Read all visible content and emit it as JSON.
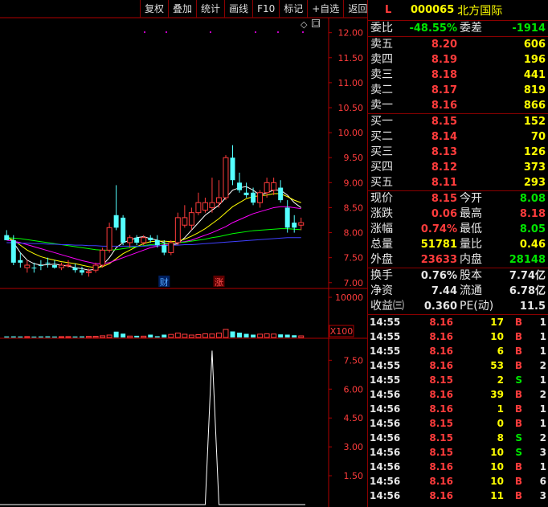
{
  "toolbar": [
    {
      "id": "fuquan",
      "label": "复权"
    },
    {
      "id": "diejia",
      "label": "叠加"
    },
    {
      "id": "tongji",
      "label": "统计"
    },
    {
      "id": "huaxian",
      "label": "画线"
    },
    {
      "id": "f10",
      "label": "F10"
    },
    {
      "id": "biaoji",
      "label": "标记"
    },
    {
      "id": "zixuan",
      "label": "+自选"
    },
    {
      "id": "fanhui",
      "label": "返回"
    }
  ],
  "chart_icons": {
    "diamond": "◇",
    "window": "□"
  },
  "header": {
    "market": "L",
    "code": "000065",
    "name": "北方国际"
  },
  "weibi": {
    "label": "委比",
    "value": "-48.55%",
    "label2": "委差",
    "value2": "-1914"
  },
  "asks": [
    {
      "label": "卖五",
      "price": "8.20",
      "vol": "606"
    },
    {
      "label": "卖四",
      "price": "8.19",
      "vol": "196"
    },
    {
      "label": "卖三",
      "price": "8.18",
      "vol": "441"
    },
    {
      "label": "卖二",
      "price": "8.17",
      "vol": "819"
    },
    {
      "label": "卖一",
      "price": "8.16",
      "vol": "866"
    }
  ],
  "bids": [
    {
      "label": "买一",
      "price": "8.15",
      "vol": "152"
    },
    {
      "label": "买二",
      "price": "8.14",
      "vol": "70"
    },
    {
      "label": "买三",
      "price": "8.13",
      "vol": "126"
    },
    {
      "label": "买四",
      "price": "8.12",
      "vol": "373"
    },
    {
      "label": "买五",
      "price": "8.11",
      "vol": "293"
    }
  ],
  "stats": [
    {
      "l1": "现价",
      "v1": "8.15",
      "c1": "red",
      "l2": "今开",
      "v2": "8.08",
      "c2": "green"
    },
    {
      "l1": "涨跌",
      "v1": "0.06",
      "c1": "red",
      "l2": "最高",
      "v2": "8.18",
      "c2": "red"
    },
    {
      "l1": "涨幅",
      "v1": "0.74%",
      "c1": "red",
      "l2": "最低",
      "v2": "8.05",
      "c2": "green"
    },
    {
      "l1": "总量",
      "v1": "51781",
      "c1": "yellow",
      "l2": "量比",
      "v2": "0.46",
      "c2": "yellow"
    },
    {
      "l1": "外盘",
      "v1": "23633",
      "c1": "red",
      "l2": "内盘",
      "v2": "28148",
      "c2": "green"
    }
  ],
  "stats2": [
    {
      "l1": "换手",
      "v1": "0.76%",
      "c1": "white",
      "l2": "股本",
      "v2": "7.74亿",
      "c2": "white"
    },
    {
      "l1": "净资",
      "v1": "7.44",
      "c1": "white",
      "l2": "流通",
      "v2": "6.78亿",
      "c2": "white"
    },
    {
      "l1": "收益㈢",
      "v1": "0.360",
      "c1": "white",
      "l2": "PE(动)",
      "v2": "11.5",
      "c2": "white"
    }
  ],
  "ticks": [
    {
      "time": "14:55",
      "price": "8.16",
      "vol": "17",
      "dir": "B",
      "n": "1"
    },
    {
      "time": "14:55",
      "price": "8.16",
      "vol": "10",
      "dir": "B",
      "n": "1"
    },
    {
      "time": "14:55",
      "price": "8.16",
      "vol": "6",
      "dir": "B",
      "n": "1"
    },
    {
      "time": "14:55",
      "price": "8.16",
      "vol": "53",
      "dir": "B",
      "n": "2"
    },
    {
      "time": "14:55",
      "price": "8.15",
      "vol": "2",
      "dir": "S",
      "n": "1"
    },
    {
      "time": "14:56",
      "price": "8.16",
      "vol": "39",
      "dir": "B",
      "n": "2"
    },
    {
      "time": "14:56",
      "price": "8.16",
      "vol": "1",
      "dir": "B",
      "n": "1"
    },
    {
      "time": "14:56",
      "price": "8.15",
      "vol": "0",
      "dir": "B",
      "n": "1"
    },
    {
      "time": "14:56",
      "price": "8.15",
      "vol": "8",
      "dir": "S",
      "n": "2"
    },
    {
      "time": "14:56",
      "price": "8.15",
      "vol": "10",
      "dir": "S",
      "n": "3"
    },
    {
      "time": "14:56",
      "price": "8.16",
      "vol": "10",
      "dir": "B",
      "n": "1"
    },
    {
      "time": "14:56",
      "price": "8.16",
      "vol": "10",
      "dir": "B",
      "n": "6"
    },
    {
      "time": "14:56",
      "price": "8.16",
      "vol": "11",
      "dir": "B",
      "n": "3"
    }
  ],
  "chart_data": [
    {
      "type": "candlestick",
      "ylim": [
        6.9,
        12.3
      ],
      "yticks": [
        "12.00",
        "11.50",
        "11.00",
        "10.50",
        "10.00",
        "9.50",
        "9.00",
        "8.50",
        "8.00",
        "7.50",
        "7.00"
      ],
      "ytick_values": [
        12.0,
        11.5,
        11.0,
        10.5,
        10.0,
        9.5,
        9.0,
        8.5,
        8.0,
        7.5,
        7.0
      ],
      "candles": [
        {
          "o": 7.95,
          "h": 8.05,
          "l": 7.85,
          "c": 7.85,
          "col": "cyan"
        },
        {
          "o": 7.85,
          "h": 7.95,
          "l": 7.35,
          "c": 7.4,
          "col": "cyan"
        },
        {
          "o": 7.45,
          "h": 7.6,
          "l": 7.3,
          "c": 7.4,
          "col": "cyan"
        },
        {
          "o": 7.35,
          "h": 7.45,
          "l": 7.2,
          "c": 7.3,
          "col": "red"
        },
        {
          "o": 7.3,
          "h": 7.4,
          "l": 7.2,
          "c": 7.3,
          "col": "cyan"
        },
        {
          "o": 7.35,
          "h": 7.45,
          "l": 7.25,
          "c": 7.35,
          "col": "cyan"
        },
        {
          "o": 7.4,
          "h": 7.5,
          "l": 7.3,
          "c": 7.4,
          "col": "cyan"
        },
        {
          "o": 7.35,
          "h": 7.45,
          "l": 7.28,
          "c": 7.3,
          "col": "cyan"
        },
        {
          "o": 7.3,
          "h": 7.4,
          "l": 7.25,
          "c": 7.35,
          "col": "red"
        },
        {
          "o": 7.35,
          "h": 7.45,
          "l": 7.3,
          "c": 7.35,
          "col": "red"
        },
        {
          "o": 7.3,
          "h": 7.38,
          "l": 7.2,
          "c": 7.25,
          "col": "cyan"
        },
        {
          "o": 7.25,
          "h": 7.32,
          "l": 7.15,
          "c": 7.2,
          "col": "cyan"
        },
        {
          "o": 7.2,
          "h": 7.28,
          "l": 7.12,
          "c": 7.22,
          "col": "red"
        },
        {
          "o": 7.25,
          "h": 7.4,
          "l": 7.2,
          "c": 7.35,
          "col": "red"
        },
        {
          "o": 7.35,
          "h": 7.7,
          "l": 7.3,
          "c": 7.65,
          "col": "red"
        },
        {
          "o": 7.65,
          "h": 8.2,
          "l": 7.6,
          "c": 8.1,
          "col": "red"
        },
        {
          "o": 8.1,
          "h": 8.95,
          "l": 8.05,
          "c": 8.35,
          "col": "cyan"
        },
        {
          "o": 8.3,
          "h": 8.35,
          "l": 7.75,
          "c": 7.8,
          "col": "cyan"
        },
        {
          "o": 7.8,
          "h": 7.95,
          "l": 7.7,
          "c": 7.9,
          "col": "red"
        },
        {
          "o": 7.9,
          "h": 7.95,
          "l": 7.75,
          "c": 7.8,
          "col": "cyan"
        },
        {
          "o": 7.8,
          "h": 7.95,
          "l": 7.75,
          "c": 7.9,
          "col": "red"
        },
        {
          "o": 7.9,
          "h": 7.95,
          "l": 7.8,
          "c": 7.85,
          "col": "cyan"
        },
        {
          "o": 7.85,
          "h": 7.95,
          "l": 7.7,
          "c": 7.75,
          "col": "cyan"
        },
        {
          "o": 7.75,
          "h": 7.85,
          "l": 7.55,
          "c": 7.6,
          "col": "cyan"
        },
        {
          "o": 7.6,
          "h": 7.85,
          "l": 7.55,
          "c": 7.8,
          "col": "red"
        },
        {
          "o": 7.8,
          "h": 8.4,
          "l": 7.75,
          "c": 8.3,
          "col": "red"
        },
        {
          "o": 8.3,
          "h": 8.55,
          "l": 8.1,
          "c": 8.15,
          "col": "red"
        },
        {
          "o": 8.15,
          "h": 8.5,
          "l": 8.05,
          "c": 8.4,
          "col": "red"
        },
        {
          "o": 8.4,
          "h": 8.8,
          "l": 8.35,
          "c": 8.6,
          "col": "red"
        },
        {
          "o": 8.6,
          "h": 8.7,
          "l": 8.4,
          "c": 8.45,
          "col": "red"
        },
        {
          "o": 8.5,
          "h": 9.1,
          "l": 8.4,
          "c": 8.6,
          "col": "red"
        },
        {
          "o": 8.6,
          "h": 9.05,
          "l": 8.5,
          "c": 8.7,
          "col": "red"
        },
        {
          "o": 8.7,
          "h": 9.55,
          "l": 8.65,
          "c": 9.5,
          "col": "red"
        },
        {
          "o": 9.5,
          "h": 9.75,
          "l": 8.95,
          "c": 9.05,
          "col": "cyan"
        },
        {
          "o": 9.0,
          "h": 9.2,
          "l": 8.8,
          "c": 8.85,
          "col": "cyan"
        },
        {
          "o": 8.8,
          "h": 9.0,
          "l": 8.7,
          "c": 8.75,
          "col": "cyan"
        },
        {
          "o": 8.8,
          "h": 8.9,
          "l": 8.55,
          "c": 8.6,
          "col": "cyan"
        },
        {
          "o": 8.6,
          "h": 8.85,
          "l": 8.5,
          "c": 8.8,
          "col": "red"
        },
        {
          "o": 8.8,
          "h": 9.1,
          "l": 8.7,
          "c": 9.0,
          "col": "red"
        },
        {
          "o": 9.0,
          "h": 9.1,
          "l": 8.75,
          "c": 8.85,
          "col": "red"
        },
        {
          "o": 8.9,
          "h": 9.05,
          "l": 8.6,
          "c": 8.65,
          "col": "cyan"
        },
        {
          "o": 8.5,
          "h": 8.65,
          "l": 8.0,
          "c": 8.1,
          "col": "cyan"
        },
        {
          "o": 8.1,
          "h": 8.35,
          "l": 8.0,
          "c": 8.2,
          "col": "cyan"
        },
        {
          "o": 8.2,
          "h": 8.3,
          "l": 8.05,
          "c": 8.15,
          "col": "red"
        }
      ],
      "ma_lines": [
        {
          "color": "#ffffff",
          "values": [
            7.95,
            7.8,
            7.6,
            7.45,
            7.38,
            7.35,
            7.36,
            7.37,
            7.35,
            7.33,
            7.3,
            7.28,
            7.25,
            7.27,
            7.35,
            7.5,
            7.7,
            7.8,
            7.85,
            7.9,
            7.92,
            7.88,
            7.85,
            7.8,
            7.75,
            7.78,
            7.9,
            8.05,
            8.2,
            8.35,
            8.45,
            8.55,
            8.7,
            8.85,
            8.9,
            8.92,
            8.85,
            8.75,
            8.8,
            8.85,
            8.85,
            8.75,
            8.6,
            8.5
          ]
        },
        {
          "color": "#ffff00",
          "values": [
            7.9,
            7.85,
            7.75,
            7.65,
            7.58,
            7.52,
            7.48,
            7.45,
            7.42,
            7.4,
            7.38,
            7.35,
            7.32,
            7.3,
            7.32,
            7.38,
            7.48,
            7.58,
            7.65,
            7.72,
            7.78,
            7.82,
            7.83,
            7.83,
            7.82,
            7.83,
            7.87,
            7.93,
            8.0,
            8.08,
            8.18,
            8.28,
            8.4,
            8.52,
            8.6,
            8.68,
            8.72,
            8.74,
            8.75,
            8.78,
            8.78,
            8.72,
            8.65,
            8.6
          ]
        },
        {
          "color": "#ff00ff",
          "values": [
            7.85,
            7.83,
            7.8,
            7.76,
            7.72,
            7.68,
            7.64,
            7.6,
            7.56,
            7.52,
            7.48,
            7.44,
            7.41,
            7.38,
            7.38,
            7.4,
            7.45,
            7.5,
            7.55,
            7.6,
            7.65,
            7.7,
            7.73,
            7.76,
            7.78,
            7.8,
            7.82,
            7.85,
            7.9,
            7.95,
            8.0,
            8.06,
            8.12,
            8.2,
            8.26,
            8.32,
            8.38,
            8.42,
            8.46,
            8.5,
            8.52,
            8.52,
            8.5,
            8.48
          ]
        },
        {
          "color": "#00ff00",
          "values": [
            7.9,
            7.89,
            7.88,
            7.86,
            7.84,
            7.82,
            7.8,
            7.78,
            7.76,
            7.74,
            7.72,
            7.7,
            7.68,
            7.66,
            7.65,
            7.65,
            7.66,
            7.68,
            7.7,
            7.72,
            7.74,
            7.76,
            7.77,
            7.78,
            7.79,
            7.8,
            7.81,
            7.83,
            7.85,
            7.87,
            7.9,
            7.92,
            7.95,
            7.98,
            8.0,
            8.02,
            8.04,
            8.05,
            8.06,
            8.07,
            8.08,
            8.08,
            8.07,
            8.06
          ]
        },
        {
          "color": "#4040ff",
          "values": [
            7.8,
            7.8,
            7.79,
            7.79,
            7.78,
            7.78,
            7.77,
            7.77,
            7.76,
            7.76,
            7.75,
            7.75,
            7.74,
            7.74,
            7.73,
            7.73,
            7.73,
            7.73,
            7.73,
            7.73,
            7.73,
            7.74,
            7.74,
            7.74,
            7.75,
            7.75,
            7.76,
            7.76,
            7.77,
            7.78,
            7.79,
            7.8,
            7.81,
            7.82,
            7.83,
            7.84,
            7.85,
            7.86,
            7.87,
            7.88,
            7.89,
            7.9,
            7.9,
            7.9
          ]
        }
      ],
      "markers": [
        {
          "index": 23,
          "label": "财",
          "color": "#54a8ff"
        },
        {
          "index": 31,
          "label": "涨",
          "color": "#ff5050"
        }
      ]
    },
    {
      "type": "bar",
      "ytick": "10000",
      "unit_label": "X100",
      "values": [
        250,
        260,
        240,
        230,
        220,
        250,
        270,
        230,
        210,
        220,
        240,
        260,
        280,
        300,
        420,
        600,
        1450,
        950,
        350,
        420,
        330,
        700,
        300,
        700,
        760,
        1100,
        800,
        600,
        700,
        900,
        860,
        1100,
        2000,
        1500,
        1200,
        900,
        700,
        820,
        900,
        850,
        760,
        700,
        550,
        400
      ]
    },
    {
      "type": "line",
      "ylim": [
        0,
        8.6
      ],
      "yticks": [
        "7.50",
        "6.00",
        "4.50",
        "3.00",
        "1.50"
      ],
      "ytick_values": [
        7.5,
        6.0,
        4.5,
        3.0,
        1.5
      ],
      "values": [
        0,
        0,
        0,
        0,
        0,
        0,
        0,
        0,
        0,
        0,
        0,
        0,
        0,
        0,
        0,
        0,
        0,
        0,
        0,
        0,
        0,
        0,
        0,
        0,
        0,
        0,
        0,
        0,
        0,
        0,
        8.0,
        0,
        0,
        0,
        0,
        0,
        0,
        0,
        0,
        0,
        0,
        0,
        0,
        0
      ]
    }
  ]
}
